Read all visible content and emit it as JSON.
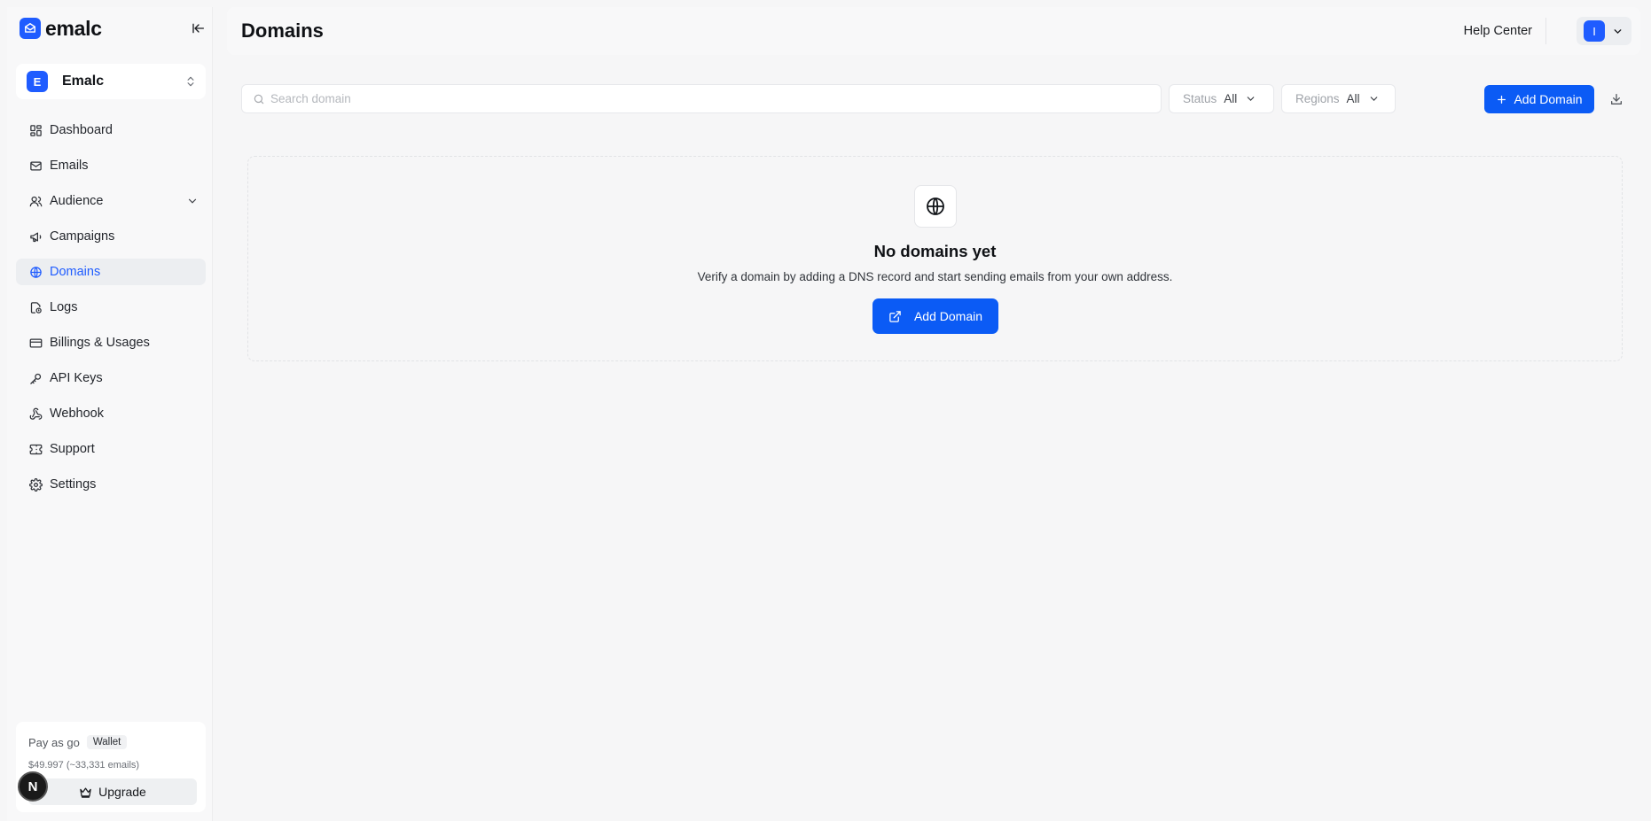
{
  "brand": {
    "name": "emalc",
    "accent": "#0b5bf5"
  },
  "workspace": {
    "initial": "E",
    "name": "Emalc"
  },
  "sidebar": {
    "items": [
      {
        "label": "Dashboard",
        "icon": "dashboard-icon"
      },
      {
        "label": "Emails",
        "icon": "mail-icon"
      },
      {
        "label": "Audience",
        "icon": "users-icon",
        "expandable": true
      },
      {
        "label": "Campaigns",
        "icon": "megaphone-icon"
      },
      {
        "label": "Domains",
        "icon": "globe-icon",
        "active": true
      },
      {
        "label": "Logs",
        "icon": "logs-icon"
      },
      {
        "label": "Billings & Usages",
        "icon": "credit-card-icon"
      },
      {
        "label": "API Keys",
        "icon": "key-icon"
      },
      {
        "label": "Webhook",
        "icon": "webhook-icon"
      },
      {
        "label": "Support",
        "icon": "ticket-icon"
      },
      {
        "label": "Settings",
        "icon": "gear-icon"
      }
    ]
  },
  "plan": {
    "name": "Pay as go",
    "badge": "Wallet",
    "balance": "$49.997 (~33,331 emails)",
    "upgrade_label": "Upgrade"
  },
  "dev_badge": "N",
  "header": {
    "title": "Domains",
    "help_label": "Help Center",
    "user_initial": "I"
  },
  "toolbar": {
    "search_placeholder": "Search domain",
    "status_label": "Status",
    "status_value": "All",
    "regions_label": "Regions",
    "regions_value": "All",
    "add_label": "Add Domain"
  },
  "empty_state": {
    "title": "No domains yet",
    "description": "Verify a domain by adding a DNS record and start sending emails from your own address.",
    "button_label": "Add Domain"
  }
}
